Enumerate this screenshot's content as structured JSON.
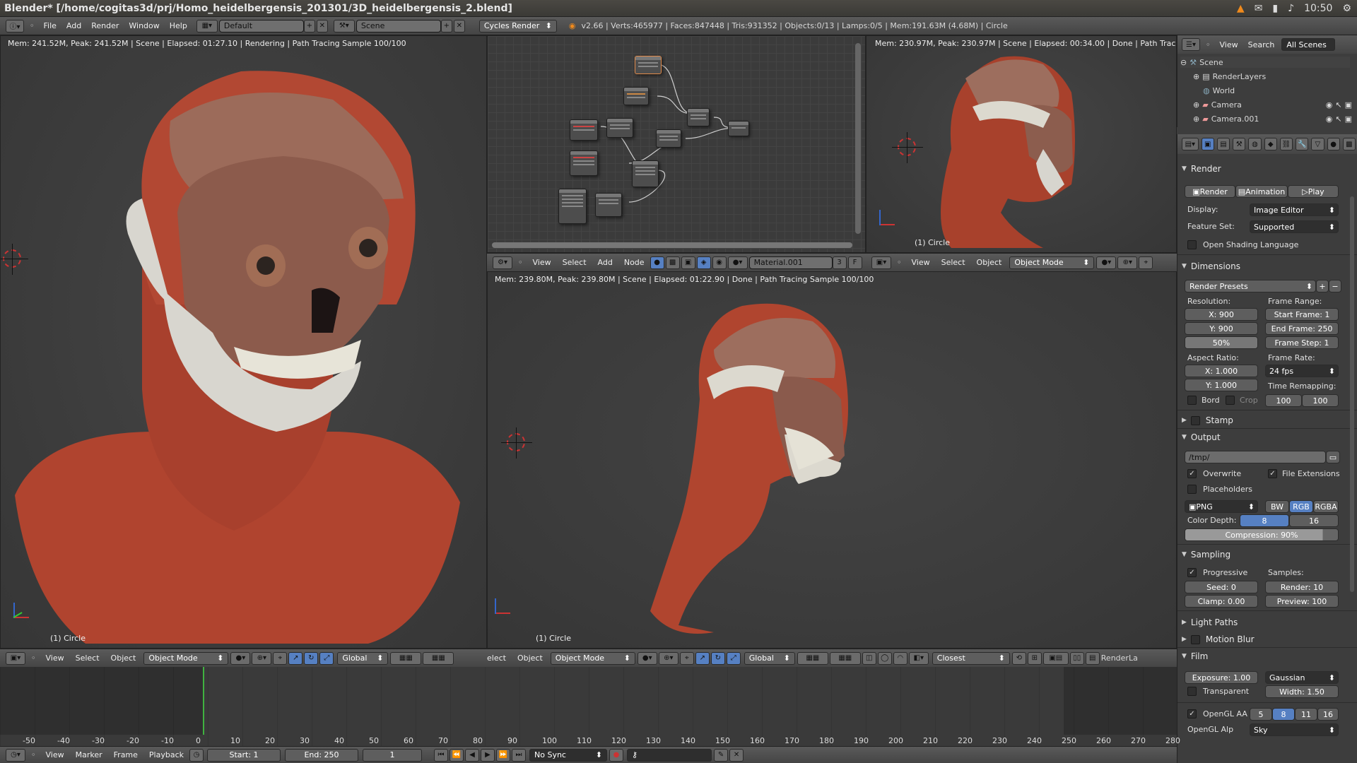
{
  "window": {
    "title": "Blender* [/home/cogitas3d/prj/Homo_heidelbergensis_201301/3D_heidelbergensis_2.blend]",
    "clock": "10:50"
  },
  "menubar": {
    "items": [
      "File",
      "Add",
      "Render",
      "Window",
      "Help"
    ],
    "layout": "Default",
    "scene": "Scene",
    "engine": "Cycles Render",
    "stats": "v2.66 | Verts:465977 | Faces:847448 | Tris:931352 | Objects:0/13 | Lamps:0/5 | Mem:191.63M (4.68M) | Circle"
  },
  "viewport_left": {
    "info": "Mem: 241.52M, Peak: 241.52M | Scene | Elapsed: 01:27.10 | Rendering | Path Tracing Sample 100/100",
    "label": "(1) Circle"
  },
  "node_editor": {
    "menus": [
      "View",
      "Select",
      "Add",
      "Node"
    ],
    "material": "Material.001",
    "users": "3",
    "fake": "F"
  },
  "viewport_topright": {
    "info": "Mem: 230.97M, Peak: 230.97M | Scene | Elapsed: 00:34.00 | Done | Path Tracing Sa",
    "label": "(1) Circle",
    "menus": [
      "View",
      "Select",
      "Object"
    ],
    "mode": "Object Mode"
  },
  "viewport_center": {
    "info": "Mem: 239.80M, Peak: 239.80M | Scene | Elapsed: 01:22.90 | Done | Path Tracing Sample 100/100",
    "label": "(1) Circle"
  },
  "header3d_left": {
    "menus": [
      "View",
      "Select",
      "Object"
    ],
    "mode": "Object Mode",
    "orientation": "Global"
  },
  "header3d_center": {
    "menus": [
      "elect",
      "Object"
    ],
    "mode": "Object Mode",
    "orientation": "Global",
    "snap": "Closest",
    "layer": "RenderLa"
  },
  "outliner": {
    "menus": [
      "View",
      "Search"
    ],
    "filter": "All Scenes",
    "items": [
      "Scene",
      "RenderLayers",
      "World",
      "Camera",
      "Camera.001"
    ]
  },
  "properties": {
    "render": {
      "title": "Render",
      "render": "Render",
      "animation": "Animation",
      "play": "Play",
      "display_label": "Display:",
      "display": "Image Editor",
      "feature_label": "Feature Set:",
      "feature": "Supported",
      "osl": "Open Shading Language"
    },
    "dimensions": {
      "title": "Dimensions",
      "presets": "Render Presets",
      "res_label": "Resolution:",
      "x": "X: 900",
      "y": "Y: 900",
      "pct": "50%",
      "range_label": "Frame Range:",
      "start": "Start Frame: 1",
      "end": "End Frame: 250",
      "step": "Frame Step: 1",
      "aspect_label": "Aspect Ratio:",
      "ax": "X: 1.000",
      "ay": "Y: 1.000",
      "rate_label": "Frame Rate:",
      "fps": "24 fps",
      "remap_label": "Time Remapping:",
      "remap_old": "100",
      "remap_new": "100",
      "bord": "Bord",
      "crop": "Crop"
    },
    "stamp": {
      "title": "Stamp"
    },
    "output": {
      "title": "Output",
      "path": "/tmp/",
      "overwrite": "Overwrite",
      "file_ext": "File Extensions",
      "placeholders": "Placeholders",
      "format": "PNG",
      "bw": "BW",
      "rgb": "RGB",
      "rgba": "RGBA",
      "depth_label": "Color Depth:",
      "d8": "8",
      "d16": "16",
      "compression": "Compression: 90%"
    },
    "sampling": {
      "title": "Sampling",
      "progressive": "Progressive",
      "samples_label": "Samples:",
      "seed": "Seed: 0",
      "render": "Render: 10",
      "clamp": "Clamp: 0.00",
      "preview": "Preview: 100"
    },
    "light_paths": {
      "title": "Light Paths"
    },
    "motion_blur": {
      "title": "Motion Blur"
    },
    "film": {
      "title": "Film",
      "exposure": "Exposure: 1.00",
      "filter": "Gaussian",
      "transparent": "Transparent",
      "width": "Width: 1.50"
    },
    "opengl": {
      "aa": "OpenGL AA",
      "aa_values": [
        "5",
        "8",
        "11",
        "16"
      ],
      "alpha_label": "OpenGL Alp",
      "alpha": "Sky"
    }
  },
  "timeline": {
    "ticks": [
      "-50",
      "-40",
      "-30",
      "-20",
      "-10",
      "0",
      "10",
      "20",
      "30",
      "40",
      "50",
      "60",
      "70",
      "80",
      "90",
      "100",
      "110",
      "120",
      "130",
      "140",
      "150",
      "160",
      "170",
      "180",
      "190",
      "200",
      "210",
      "220",
      "230",
      "240",
      "250",
      "260",
      "270",
      "280"
    ],
    "menus": [
      "View",
      "Marker",
      "Frame",
      "Playback"
    ],
    "start": "Start: 1",
    "end": "End: 250",
    "current": "1",
    "sync": "No Sync"
  },
  "colors": {
    "accent_blue": "#5680c2",
    "skin": "#b44a36",
    "bone": "#d9d7cf",
    "playhead": "#3fb23f"
  }
}
